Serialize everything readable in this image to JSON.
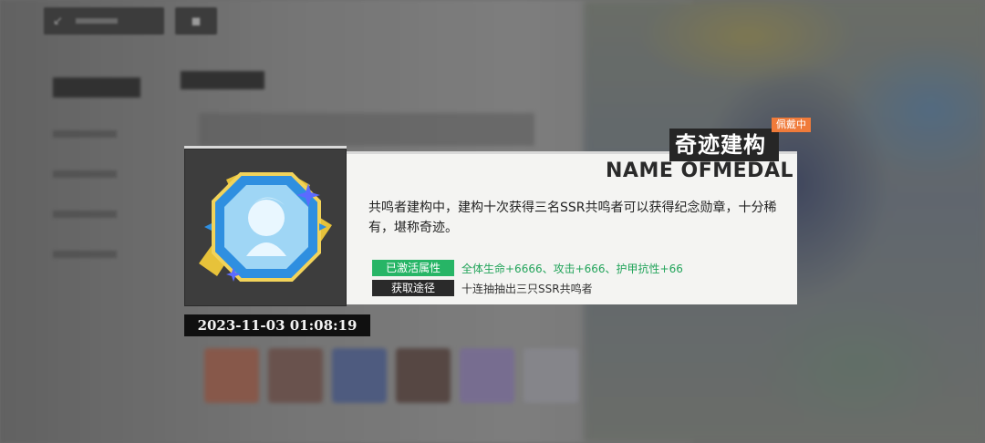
{
  "medal": {
    "title": "奇迹建构",
    "english_name": "NAME OFMEDAL",
    "status_badge": "佩戴中",
    "description": "共鸣者建构中，建构十次获得三名SSR共鸣者可以获得纪念勋章，十分稀有，堪称奇迹。",
    "active_attr_label": "已激活属性",
    "active_attr_value": "全体生命+6666、攻击+666、护甲抗性+66",
    "source_label": "获取途径",
    "source_value": "十连抽抽出三只SSR共鸣者",
    "timestamp": "2023-11-03 01:08:19",
    "icon": "resonator-medal-icon"
  },
  "colors": {
    "active_green": "#27b566",
    "badge_orange": "#f07b3a",
    "medal_gold": "#e7c23a",
    "medal_blue": "#2f8fe0"
  }
}
